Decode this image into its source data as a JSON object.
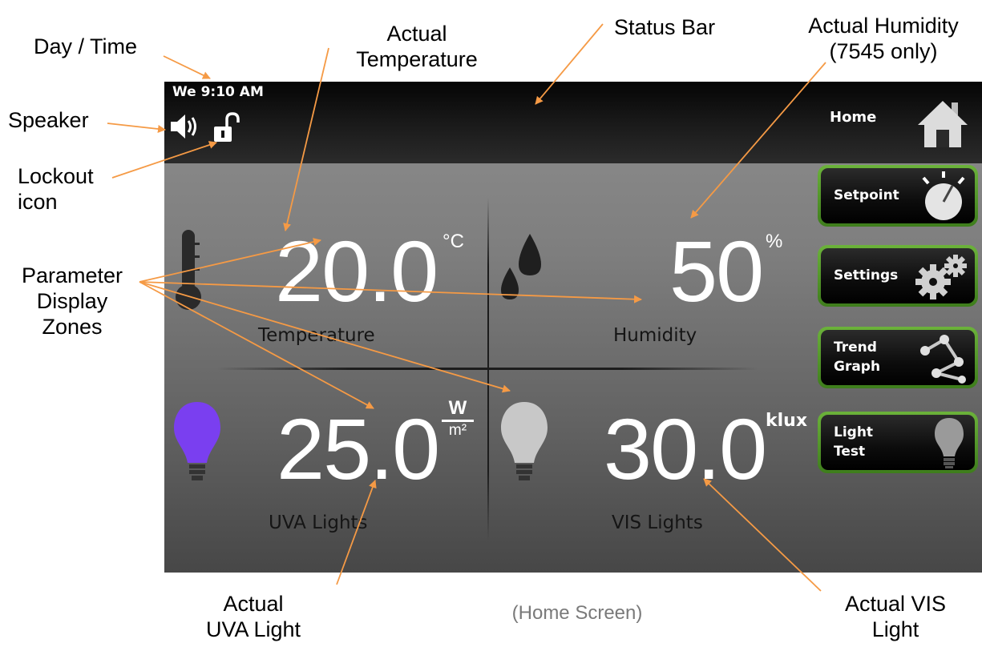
{
  "annotations": {
    "day_time": "Day / Time",
    "actual_temperature": "Actual\nTemperature",
    "status_bar": "Status Bar",
    "actual_humidity": "Actual Humidity\n(7545 only)",
    "speaker": "Speaker",
    "lockout_icon": "Lockout\nicon",
    "parameter_zones": "Parameter\nDisplay\nZones",
    "actual_uva": "Actual\nUVA Light",
    "actual_vis": "Actual VIS\nLight",
    "caption": "(Home Screen)"
  },
  "status_bar": {
    "day_time": "We 9:10 AM",
    "home_label": "Home"
  },
  "zones": {
    "temperature": {
      "value": "20.0",
      "unit": "°C",
      "label": "Temperature"
    },
    "humidity": {
      "value": "50",
      "unit": "%",
      "label": "Humidity"
    },
    "uva": {
      "value": "25.0",
      "unit_num": "W",
      "unit_den": "m²",
      "label": "UVA Lights"
    },
    "vis": {
      "value": "30.0",
      "unit": "klux",
      "label": "VIS Lights"
    }
  },
  "side_buttons": {
    "setpoint": "Setpoint",
    "settings": "Settings",
    "trend_graph": "Trend\nGraph",
    "light_test": "Light\nTest"
  },
  "colors": {
    "arrow": "#f59a45",
    "button_border": "#5aa02c",
    "uva_bulb": "#7a3ff0",
    "vis_bulb": "#c8c8c8"
  }
}
